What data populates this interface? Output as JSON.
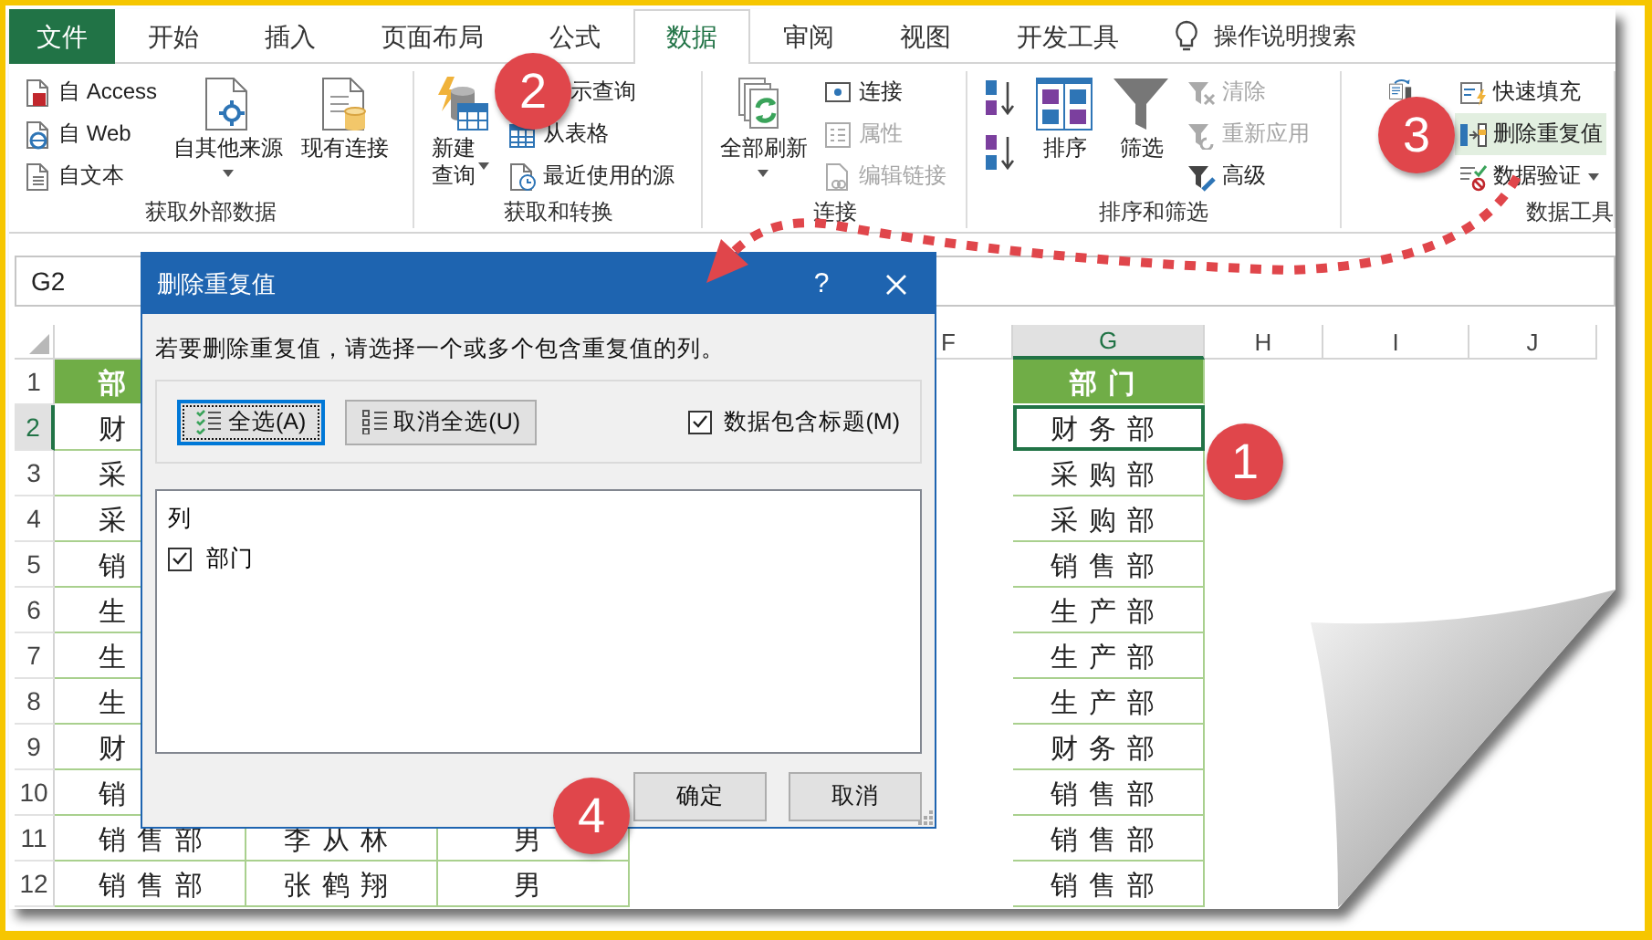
{
  "tabs": [
    {
      "label": "文件",
      "kind": "file",
      "selected": false
    },
    {
      "label": "开始",
      "kind": "tab",
      "selected": false
    },
    {
      "label": "插入",
      "kind": "tab",
      "selected": false
    },
    {
      "label": "页面布局",
      "kind": "tab",
      "selected": false
    },
    {
      "label": "公式",
      "kind": "tab",
      "selected": false
    },
    {
      "label": "数据",
      "kind": "tab",
      "selected": true
    },
    {
      "label": "审阅",
      "kind": "tab",
      "selected": false
    },
    {
      "label": "视图",
      "kind": "tab",
      "selected": false
    },
    {
      "label": "开发工具",
      "kind": "tab",
      "selected": false
    }
  ],
  "tell_me": "操作说明搜索",
  "ribbon_groups": [
    {
      "label": "获取外部数据",
      "columns": [
        {
          "items": [
            {
              "kind": "small",
              "label": "自 Access"
            },
            {
              "kind": "small",
              "label": "自 Web"
            },
            {
              "kind": "small",
              "label": "自文本"
            }
          ]
        },
        {
          "items": [
            {
              "kind": "large",
              "label": "自其他来源",
              "dropdown": true
            }
          ]
        },
        {
          "items": [
            {
              "kind": "large",
              "label": "现有连接",
              "dropdown": false
            }
          ]
        }
      ]
    },
    {
      "label": "获取和转换",
      "columns": [
        {
          "items": [
            {
              "kind": "large",
              "label": "新建查询",
              "dropdown": true
            }
          ]
        },
        {
          "items": [
            {
              "kind": "small",
              "label": "示查询"
            },
            {
              "kind": "small",
              "label": "从表格"
            },
            {
              "kind": "small",
              "label": "最近使用的源"
            }
          ]
        }
      ]
    },
    {
      "label": "连接",
      "columns": [
        {
          "items": [
            {
              "kind": "large",
              "label": "全部刷新",
              "dropdown": true
            }
          ]
        },
        {
          "items": [
            {
              "kind": "small",
              "label": "连接",
              "disabled": false
            },
            {
              "kind": "small",
              "label": "属性",
              "disabled": true
            },
            {
              "kind": "small",
              "label": "编辑链接",
              "disabled": true
            }
          ]
        }
      ]
    },
    {
      "label": "排序和筛选",
      "columns": [
        {
          "items": [
            {
              "kind": "icon"
            },
            {
              "kind": "icon"
            }
          ]
        },
        {
          "items": [
            {
              "kind": "large",
              "label": "排序",
              "dropdown": false
            }
          ]
        },
        {
          "items": [
            {
              "kind": "large",
              "label": "筛选",
              "dropdown": false
            }
          ]
        },
        {
          "items": [
            {
              "kind": "small",
              "label": "清除",
              "disabled": true
            },
            {
              "kind": "small",
              "label": "重新应用",
              "disabled": true
            },
            {
              "kind": "small",
              "label": "高级",
              "disabled": false
            }
          ]
        }
      ]
    },
    {
      "label": "数据工具",
      "columns": [
        {
          "items": [
            {
              "kind": "large"
            }
          ]
        },
        {
          "items": [
            {
              "kind": "small",
              "label": "快速填充",
              "highlighted": false,
              "dropdown": false
            },
            {
              "kind": "small",
              "label": "删除重复值",
              "highlighted": true,
              "dropdown": false
            },
            {
              "kind": "small",
              "label": "数据验证",
              "highlighted": false,
              "dropdown": true
            }
          ]
        }
      ]
    }
  ],
  "name_box": "G2",
  "sheet": {
    "columns": [
      {
        "label": "F",
        "selected": false
      },
      {
        "label": "G",
        "selected": true
      },
      {
        "label": "H",
        "selected": false
      },
      {
        "label": "I",
        "selected": false
      },
      {
        "label": "J",
        "selected": false
      }
    ],
    "rows": [
      {
        "header": "1",
        "kind": "header",
        "selected": false,
        "column_a": "部",
        "column_g": "部门"
      },
      {
        "header": "2",
        "kind": "data",
        "selected": true,
        "column_a": "财",
        "column_g": "财务部"
      },
      {
        "header": "3",
        "kind": "data",
        "selected": false,
        "column_a": "采",
        "column_g": "采购部"
      },
      {
        "header": "4",
        "kind": "data",
        "selected": false,
        "column_a": "采",
        "column_g": "采购部"
      },
      {
        "header": "5",
        "kind": "data",
        "selected": false,
        "column_a": "销",
        "column_g": "销售部"
      },
      {
        "header": "6",
        "kind": "data",
        "selected": false,
        "column_a": "生",
        "column_g": "生产部"
      },
      {
        "header": "7",
        "kind": "data",
        "selected": false,
        "column_a": "生",
        "column_g": "生产部"
      },
      {
        "header": "8",
        "kind": "data",
        "selected": false,
        "column_a": "生",
        "column_g": "生产部"
      },
      {
        "header": "9",
        "kind": "data",
        "selected": false,
        "column_a": "财",
        "column_g": "财务部"
      },
      {
        "header": "10",
        "kind": "data",
        "selected": false,
        "column_a": "销",
        "column_g": "销售部"
      },
      {
        "header": "11",
        "kind": "data",
        "selected": false,
        "column_a": "销售部",
        "column_b": "李从林",
        "column_c": "男",
        "column_g": "销售部"
      },
      {
        "header": "12",
        "kind": "data",
        "selected": false,
        "column_a": "销售部",
        "column_b": "张鹤翔",
        "column_c": "男",
        "column_g": "销售部"
      }
    ]
  },
  "dialog": {
    "title": "删除重复值",
    "help": "?",
    "instruction": "若要删除重复值，请选择一个或多个包含重复值的列。",
    "select_all": {
      "label": "全选(A)",
      "focused": true
    },
    "unselect_all": {
      "label": "取消全选(U)",
      "focused": false
    },
    "has_headers": {
      "label": "数据包含标题(M)",
      "checked": true
    },
    "list_header": "列",
    "columns": [
      {
        "label": "部门",
        "checked": true
      }
    ],
    "buttons": [
      {
        "label": "确定"
      },
      {
        "label": "取消"
      }
    ]
  },
  "callouts": [
    {
      "label": "1"
    },
    {
      "label": "2"
    },
    {
      "label": "3"
    },
    {
      "label": "4"
    }
  ]
}
